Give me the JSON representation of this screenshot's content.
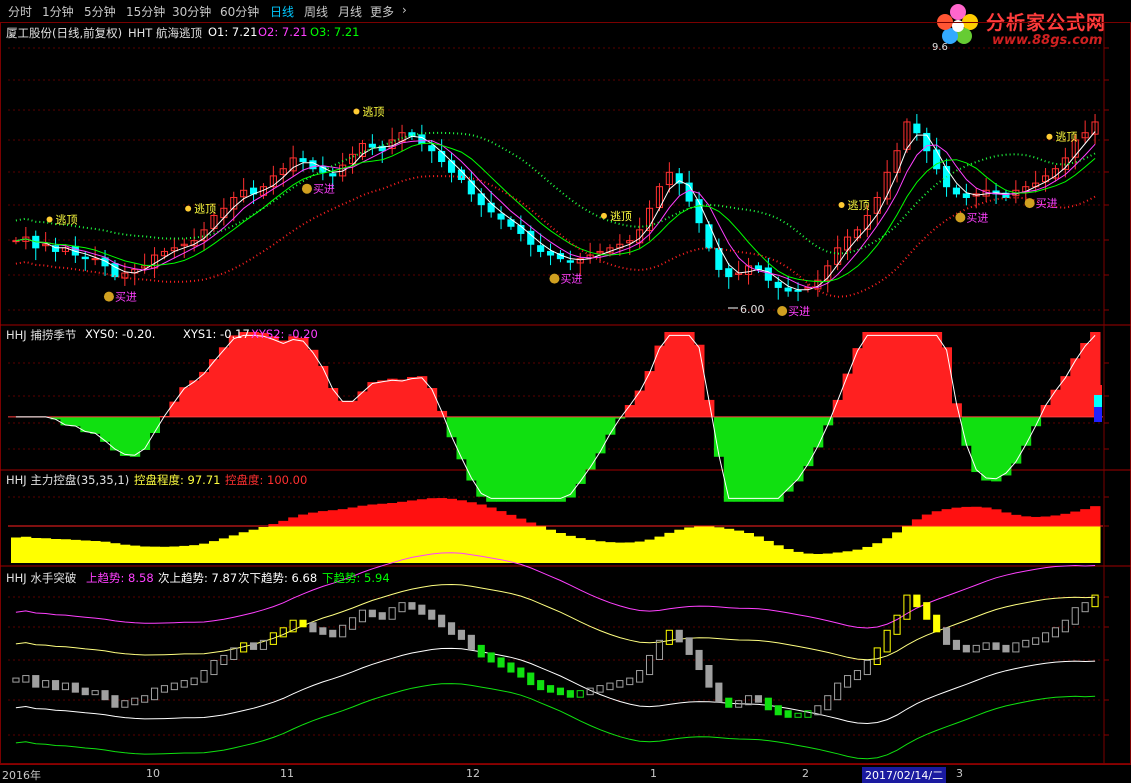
{
  "toolbar": {
    "items": [
      {
        "label": "分时",
        "active": false
      },
      {
        "label": "1分钟",
        "active": false
      },
      {
        "label": "5分钟",
        "active": false
      },
      {
        "label": "15分钟",
        "active": false
      },
      {
        "label": "30分钟",
        "active": false
      },
      {
        "label": "60分钟",
        "active": false
      },
      {
        "label": "日线",
        "active": true
      },
      {
        "label": "周线",
        "active": false
      },
      {
        "label": "月线",
        "active": false
      },
      {
        "label": "更多",
        "active": false
      }
    ],
    "more_icon": "chevron-right-icon"
  },
  "logo": {
    "title": "分析家公式网",
    "url": "www.88gs.com",
    "icon": "flower-icon"
  },
  "panels": {
    "main": {
      "title": "厦工股份(日线,前复权)",
      "indicator": "HHT 航海逃顶",
      "values": [
        {
          "label": "O1: 7.21",
          "color": "#ffffff"
        },
        {
          "label": "O2: 7.21",
          "color": "#ff40ff"
        },
        {
          "label": "O3: 7.21",
          "color": "#00ff00"
        }
      ],
      "low_label": "6.00",
      "high_label": "9.6",
      "signal_sell": "逃顶",
      "signal_buy": "买进"
    },
    "p2": {
      "title": "HHJ 捕捞季节",
      "values": [
        {
          "label": "XYS0: -0.20.",
          "color": "#ffffff"
        },
        {
          "label": "XYS1: -0.17",
          "color": "#ffffff"
        },
        {
          "label": "XYS2: -0.20",
          "color": "#ff40ff"
        }
      ]
    },
    "p3": {
      "title": "HHJ 主力控盘(35,35,1)",
      "values": [
        {
          "label": "控盘程度: 97.71",
          "color": "#ffff40"
        },
        {
          "label": "控盘度: 100.00",
          "color": "#ff3030"
        }
      ]
    },
    "p4": {
      "title": "HHJ 水手突破",
      "values": [
        {
          "label": "上趋势: 8.58",
          "color": "#ff40ff"
        },
        {
          "label": "次上趋势: 7.87",
          "color": "#ffffff"
        },
        {
          "label": "次下趋势: 6.68",
          "color": "#ffffff"
        },
        {
          "label": "下趋势: 5.94",
          "color": "#00ff00"
        }
      ]
    }
  },
  "date_axis": {
    "labels": [
      "2016年",
      "10",
      "11",
      "12",
      "1",
      "2",
      "3"
    ],
    "cursor_date": "2017/02/14/二"
  },
  "colors": {
    "up": "#ff3030",
    "down": "#00ffff",
    "grid": "#7a0000",
    "accent": "#00c8ff"
  },
  "chart_data": {
    "type": "candlestick",
    "price_range": [
      6.0,
      9.6
    ],
    "close": [
      6.95,
      7.0,
      6.85,
      6.9,
      6.8,
      6.85,
      6.75,
      6.7,
      6.7,
      6.6,
      6.45,
      6.5,
      6.55,
      6.6,
      6.75,
      6.8,
      6.85,
      6.9,
      6.95,
      7.1,
      7.3,
      7.4,
      7.55,
      7.65,
      7.6,
      7.7,
      7.85,
      7.95,
      8.1,
      8.05,
      7.95,
      7.9,
      7.85,
      8.0,
      8.15,
      8.3,
      8.25,
      8.2,
      8.35,
      8.45,
      8.4,
      8.3,
      8.2,
      8.05,
      7.9,
      7.8,
      7.6,
      7.45,
      7.35,
      7.25,
      7.15,
      7.05,
      6.9,
      6.8,
      6.75,
      6.7,
      6.65,
      6.7,
      6.75,
      6.8,
      6.85,
      6.9,
      6.95,
      7.1,
      7.4,
      7.7,
      7.9,
      7.75,
      7.5,
      7.2,
      6.85,
      6.55,
      6.45,
      6.5,
      6.6,
      6.55,
      6.4,
      6.3,
      6.25,
      6.25,
      6.3,
      6.4,
      6.6,
      6.85,
      7.0,
      7.1,
      7.3,
      7.55,
      7.9,
      8.2,
      8.6,
      8.45,
      8.2,
      7.95,
      7.7,
      7.6,
      7.55,
      7.6,
      7.65,
      7.6,
      7.55,
      7.65,
      7.7,
      7.75,
      7.85,
      7.95,
      8.1,
      8.35,
      8.45,
      8.6
    ],
    "signals_sell_index": [
      4,
      18,
      35,
      60,
      84,
      105
    ],
    "signals_buy_index": [
      10,
      30,
      55,
      78,
      96,
      103
    ],
    "mm_range": [
      -1,
      1
    ],
    "kp_range": [
      0,
      100
    ],
    "sailor_range": [
      5.5,
      9.0
    ]
  }
}
